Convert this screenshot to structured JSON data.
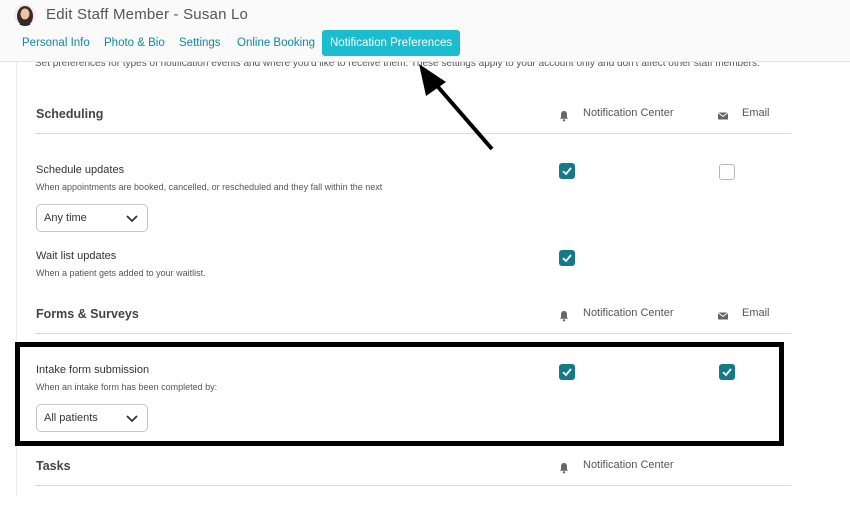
{
  "header": {
    "title": "Edit Staff Member - Susan Lo",
    "tabs": [
      {
        "label": "Personal Info"
      },
      {
        "label": "Photo & Bio"
      },
      {
        "label": "Settings"
      },
      {
        "label": "Online Booking"
      },
      {
        "label": "Notification Preferences",
        "active": true
      }
    ]
  },
  "intro": "Set preferences for types of notification events and where you'd like to receive them. These settings apply to your account only and don't affect other staff members.",
  "columns": {
    "notification_center": "Notification Center",
    "email": "Email"
  },
  "sections": {
    "scheduling": {
      "title": "Scheduling",
      "schedule_updates": {
        "title": "Schedule updates",
        "desc": "When appointments are booked, cancelled, or rescheduled and they fall within the next",
        "select": "Any time",
        "notification_center": true,
        "email": false
      },
      "wait_list": {
        "title": "Wait list updates",
        "desc": "When a patient gets added to your waitlist.",
        "notification_center": true
      }
    },
    "forms": {
      "title": "Forms & Surveys",
      "intake": {
        "title": "Intake form submission",
        "desc": "When an intake form has been completed by:",
        "select": "All patients",
        "notification_center": true,
        "email": true
      }
    },
    "tasks": {
      "title": "Tasks"
    }
  },
  "colors": {
    "accent": "#1bbccd",
    "link": "#0b8ca0",
    "checkbox": "#157a87"
  },
  "icons": {
    "bell": "bell-icon",
    "mail": "mail-icon",
    "check": "check-icon",
    "chevron": "chevron-down-icon"
  }
}
